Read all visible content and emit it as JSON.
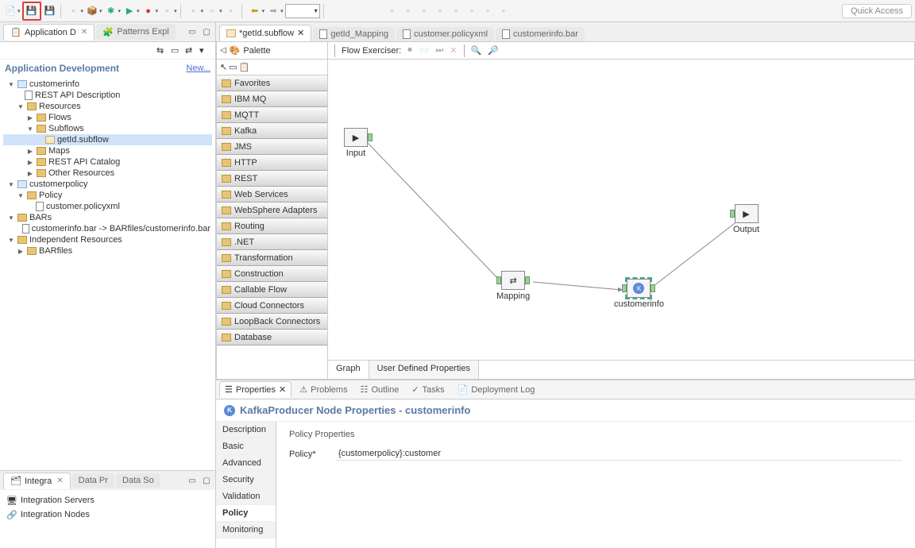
{
  "toolbar": {
    "quick_access": "Quick Access"
  },
  "left_views": {
    "appdev_tab": "Application D",
    "patterns_tab": "Patterns Expl",
    "appdev_title": "Application Development",
    "new_link": "New...",
    "integra_tab": "Integra",
    "datapr_tab": "Data Pr",
    "dataso_tab": "Data So",
    "int_servers": "Integration Servers",
    "int_nodes": "Integration Nodes"
  },
  "tree": {
    "customerinfo": "customerinfo",
    "restapi_desc": "REST API Description",
    "resources": "Resources",
    "flows": "Flows",
    "subflows": "Subflows",
    "getid_subflow": "getId.subflow",
    "maps": "Maps",
    "restapi_catalog": "REST API Catalog",
    "other_resources": "Other Resources",
    "customerpolicy": "customerpolicy",
    "policy": "Policy",
    "customer_policyxml": "customer.policyxml",
    "bars": "BARs",
    "customerinfo_bar": "customerinfo.bar -> BARfiles/customerinfo.bar",
    "independent": "Independent Resources",
    "barfiles": "BARfiles"
  },
  "editor_tabs": {
    "getid_subflow": "*getId.subflow",
    "getid_mapping": "getId_Mapping",
    "customer_policyxml": "customer.policyxml",
    "customerinfo_bar": "customerinfo.bar"
  },
  "palette": {
    "title": "Palette",
    "drawers": [
      "Favorites",
      "IBM MQ",
      "MQTT",
      "Kafka",
      "JMS",
      "HTTP",
      "REST",
      "Web Services",
      "WebSphere Adapters",
      "Routing",
      ".NET",
      "Transformation",
      "Construction",
      "Callable Flow",
      "Cloud Connectors",
      "LoopBack Connectors",
      "Database"
    ]
  },
  "flow": {
    "exerciser_label": "Flow Exerciser:",
    "nodes": {
      "input": "Input",
      "mapping": "Mapping",
      "customerinfo": "customerinfo",
      "output": "Output"
    },
    "tabs": {
      "graph": "Graph",
      "udp": "User Defined Properties"
    }
  },
  "bottom": {
    "tabs": {
      "properties": "Properties",
      "problems": "Problems",
      "outline": "Outline",
      "tasks": "Tasks",
      "deploylog": "Deployment Log"
    },
    "header": "KafkaProducer Node Properties - customerinfo",
    "nav": [
      "Description",
      "Basic",
      "Advanced",
      "Security",
      "Validation",
      "Policy",
      "Monitoring"
    ],
    "section_title": "Policy Properties",
    "policy_label": "Policy*",
    "policy_value": "{customerpolicy}:customer"
  }
}
